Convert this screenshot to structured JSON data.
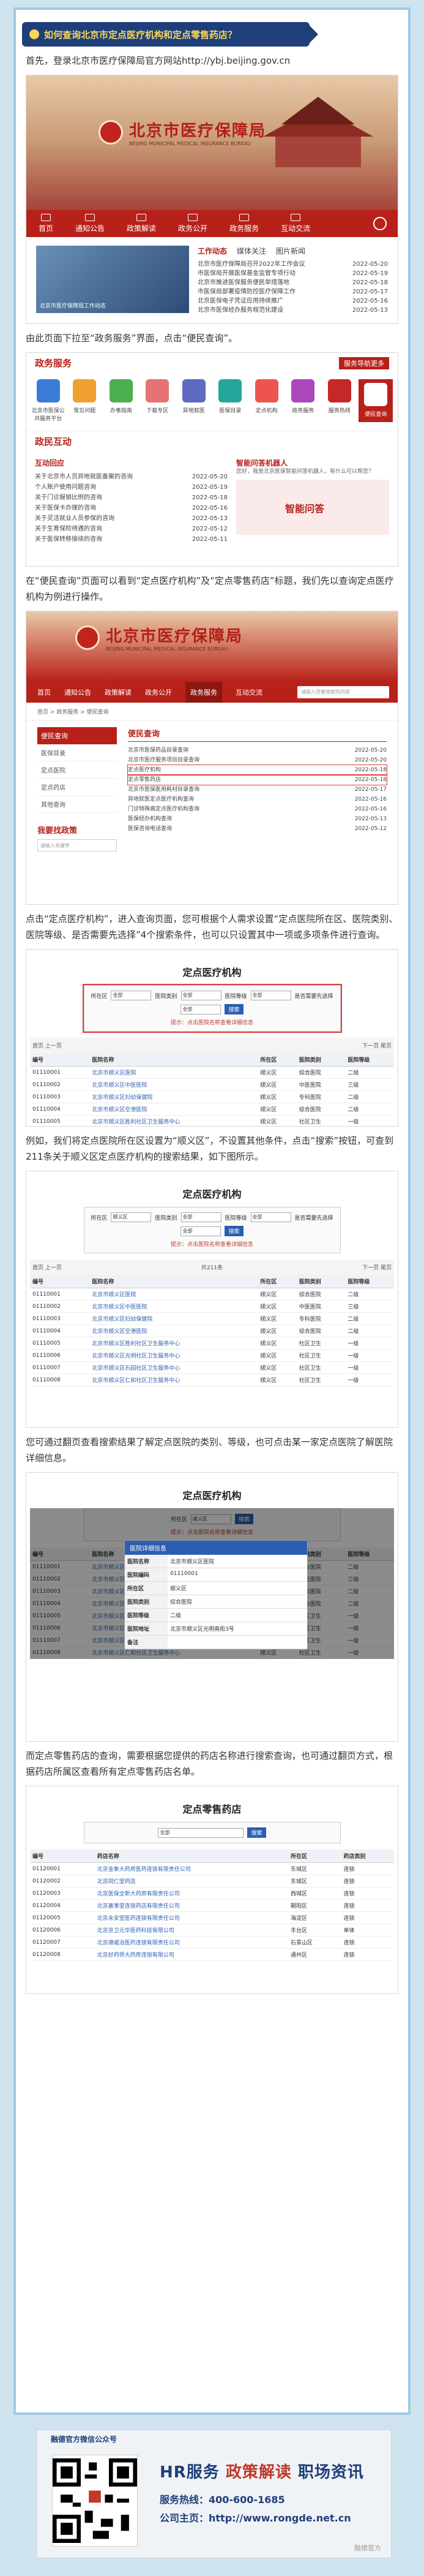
{
  "headline": "如何查询北京市定点医疗机构和定点零售药店？",
  "paragraphs": {
    "p1": "首先，登录北京市医疗保障局官方网站http://ybj.beijing.gov.cn",
    "p2": "由此页面下拉至“政务服务”界面，点击“便民查询”。",
    "p3": "在“便民查询”页面可以看到“定点医疗机构”及“定点零售药店”标题，我们先以查询定点医疗机构为例进行操作。",
    "p4": "点击“定点医疗机构”，进入查询页面，您可根据个人需求设置“定点医院所在区、医院类别、医院等级、是否需要先选择”4个搜索条件，也可以只设置其中一项或多项条件进行查询。",
    "p5": "例如，我们将定点医院所在区设置为“顺义区”，不设置其他条件，点击“搜索”按钮，可查到211条关于顺义区定点医疗机构的搜索结果，如下图所示。",
    "p6": "您可通过翻页查看搜索结果了解定点医院的类别、等级，也可点击某一家定点医院了解医院详细信息。",
    "p7": "而定点零售药店的查询，需要根据您提供的药店名称进行搜索查询，也可通过翻页方式，根据药店所属区查看所有定点零售药店名单。"
  },
  "site": {
    "name": "北京市医疗保障局",
    "name_en": "BEIJING MUNICIPAL MEDICAL INSURANCE BUREAU",
    "nav": [
      "首页",
      "通知公告",
      "政策解读",
      "政务公开",
      "政务服务",
      "互动交流"
    ],
    "news_tabs": [
      "工作动态",
      "媒体关注",
      "图片新闻"
    ],
    "news": [
      {
        "t": "北京市医疗保障局召开2022年工作会议",
        "d": "2022-05-20"
      },
      {
        "t": "市医保局开展医保基金监管专项行动",
        "d": "2022-05-19"
      },
      {
        "t": "北京市推进医保服务便民举措落地",
        "d": "2022-05-18"
      },
      {
        "t": "市医保局部署疫情防控医疗保障工作",
        "d": "2022-05-17"
      },
      {
        "t": "北京医保电子凭证应用持续推广",
        "d": "2022-05-16"
      },
      {
        "t": "北京市医保经办服务规范化建设",
        "d": "2022-05-13"
      }
    ],
    "news_caption": "北京市医疗保障局工作动态",
    "gov_service_title": "政务服务",
    "gov_service_more": "服务导航更多",
    "services": [
      "北京市医保公共服务平台",
      "常见问题",
      "办事指南",
      "下载专区",
      "异地就医",
      "医保目录",
      "定点机构",
      "政务服务",
      "服务热线",
      "便民查询"
    ],
    "interact_title": "政民互动",
    "interact_tab": "互动回应",
    "interact_list": [
      {
        "t": "关于北京市人员异地就医备案的咨询",
        "d": "2022-05-20"
      },
      {
        "t": "个人账户使用问题咨询",
        "d": "2022-05-19"
      },
      {
        "t": "关于门诊报销比例的咨询",
        "d": "2022-05-18"
      },
      {
        "t": "关于医保卡办理的咨询",
        "d": "2022-05-16"
      },
      {
        "t": "关于灵活就业人员参保的咨询",
        "d": "2022-05-13"
      },
      {
        "t": "关于生育保险待遇的咨询",
        "d": "2022-05-12"
      },
      {
        "t": "关于医保转移接续的咨询",
        "d": "2022-05-11"
      }
    ],
    "smart_title": "智能问答机器人",
    "smart_desc": "您好，我是北京医保智能问答机器人，有什么可以帮您？",
    "smart_box": "智能问答",
    "search_placeholder": "请输入您要搜索的内容"
  },
  "bianmin": {
    "crumb": "首页 > 政务服务 > 便民查询",
    "side_head": "便民查询",
    "side_items": [
      "医保目录",
      "定点医院",
      "定点药店",
      "其他查询"
    ],
    "side_h2": "我要找政策",
    "side_input": "请输入关键字",
    "main_head": "便民查询",
    "list": [
      {
        "t": "北京市医保药品目录查询",
        "d": "2022-05-20",
        "mark": false
      },
      {
        "t": "北京市医疗服务项目目录查询",
        "d": "2022-05-20",
        "mark": false
      },
      {
        "t": "定点医疗机构",
        "d": "2022-05-18",
        "mark": true
      },
      {
        "t": "定点零售药店",
        "d": "2022-05-18",
        "mark": true
      },
      {
        "t": "北京市医保医用耗材目录查询",
        "d": "2022-05-17",
        "mark": false
      },
      {
        "t": "异地就医定点医疗机构查询",
        "d": "2022-05-16",
        "mark": false
      },
      {
        "t": "门诊特殊病定点医疗机构查询",
        "d": "2022-05-16",
        "mark": false
      },
      {
        "t": "医保经办机构查询",
        "d": "2022-05-13",
        "mark": false
      },
      {
        "t": "医保咨询电话查询",
        "d": "2022-05-12",
        "mark": false
      }
    ]
  },
  "query": {
    "title_hosp": "定点医疗机构",
    "title_pharm": "定点零售药店",
    "filter_labels": [
      "所在区",
      "医院类别",
      "医院等级",
      "是否需要先选择"
    ],
    "filter_default": "全部",
    "district_value": "顺义区",
    "search_btn": "搜索",
    "note": "提示：点击医院名称查看详细信息",
    "pager_prev": "首页 上一页",
    "pager_info": "共211条",
    "pager_next": "下一页 尾页",
    "columns": [
      "编号",
      "医院名称",
      "所在区",
      "医院类别",
      "医院等级"
    ],
    "rows": [
      [
        "01110001",
        "北京市顺义区医院",
        "顺义区",
        "综合医院",
        "二级"
      ],
      [
        "01110002",
        "北京市顺义区中医医院",
        "顺义区",
        "中医医院",
        "三级"
      ],
      [
        "01110003",
        "北京市顺义区妇幼保健院",
        "顺义区",
        "专科医院",
        "二级"
      ],
      [
        "01110004",
        "北京市顺义区空港医院",
        "顺义区",
        "综合医院",
        "二级"
      ],
      [
        "01110005",
        "北京市顺义区胜利社区卫生服务中心",
        "顺义区",
        "社区卫生",
        "一级"
      ],
      [
        "01110006",
        "北京市顺义区光明社区卫生服务中心",
        "顺义区",
        "社区卫生",
        "一级"
      ],
      [
        "01110007",
        "北京市顺义区石园社区卫生服务中心",
        "顺义区",
        "社区卫生",
        "一级"
      ],
      [
        "01110008",
        "北京市顺义区仁和社区卫生服务中心",
        "顺义区",
        "社区卫生",
        "一级"
      ]
    ],
    "popup_title": "医院详细信息",
    "popup": [
      {
        "k": "医院名称",
        "v": "北京市顺义区医院"
      },
      {
        "k": "医院编码",
        "v": "01110001"
      },
      {
        "k": "所在区",
        "v": "顺义区"
      },
      {
        "k": "医院类别",
        "v": "综合医院"
      },
      {
        "k": "医院等级",
        "v": "二级"
      },
      {
        "k": "医院地址",
        "v": "北京市顺义区光明南街3号"
      },
      {
        "k": "备注",
        "v": ""
      }
    ],
    "pharm_columns": [
      "编号",
      "药店名称",
      "所在区",
      "药店类别"
    ],
    "pharm_rows": [
      [
        "01120001",
        "北京金象大药房医药连锁有限责任公司",
        "东城区",
        "连锁"
      ],
      [
        "01120002",
        "北京同仁堂药店",
        "东城区",
        "连锁"
      ],
      [
        "01120003",
        "北京医保全新大药房有限责任公司",
        "西城区",
        "连锁"
      ],
      [
        "01120004",
        "北京嘉事堂连锁药店有限责任公司",
        "朝阳区",
        "连锁"
      ],
      [
        "01120005",
        "北京永安堂医药连锁有限责任公司",
        "海淀区",
        "连锁"
      ],
      [
        "01120006",
        "北京京卫元华医药科技有限公司",
        "丰台区",
        "单体"
      ],
      [
        "01120007",
        "北京德威治医药连锁有限责任公司",
        "石景山区",
        "连锁"
      ],
      [
        "01120008",
        "北京好药师大药房连锁有限公司",
        "通州区",
        "连锁"
      ]
    ]
  },
  "footer": {
    "label": "融德官方微信公众号",
    "big1": "HR服务",
    "big2": "政策解读",
    "big3": "职场资讯",
    "line1": "服务热线：400-600-1685",
    "line2": "公司主页：http://www.rongde.net.cn",
    "watermark": "融德官方"
  }
}
